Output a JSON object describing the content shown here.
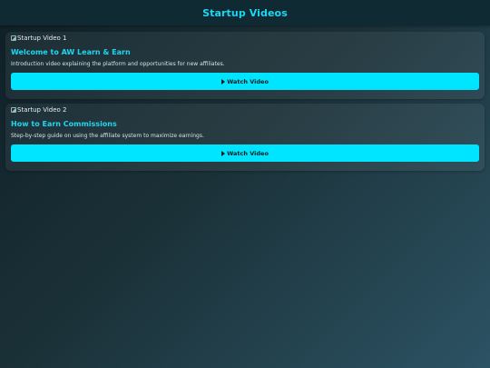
{
  "header": {
    "title": "Startup Videos"
  },
  "videos": [
    {
      "thumbnail_alt": "Startup Video 1",
      "title": "Welcome to AW Learn & Earn",
      "description": "Introduction video explaining the platform and opportunities for new affiliates.",
      "button_label": "Watch Video"
    },
    {
      "thumbnail_alt": "Startup Video 2",
      "title": "How to Earn Commissions",
      "description": "Step-by-step guide on using the affiliate system to maximize earnings.",
      "button_label": "Watch Video"
    }
  ],
  "colors": {
    "accent": "#1fd6f0",
    "button": "#00e5ff",
    "header_bg": "#102a33"
  },
  "icons": {
    "play": "play-icon",
    "broken_image": "broken-image-icon"
  }
}
